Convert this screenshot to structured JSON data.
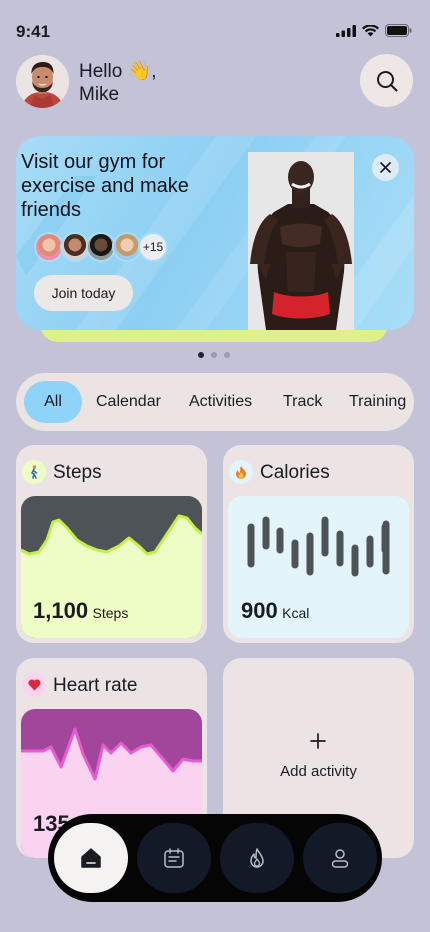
{
  "status": {
    "time": "9:41"
  },
  "header": {
    "greeting_line1": "Hello 👋,",
    "greeting_line2": "Mike"
  },
  "promo": {
    "title": "Visit our gym for exercise and make friends",
    "members_extra": "+15",
    "join_label": "Join today"
  },
  "tabs": [
    {
      "label": "All",
      "active": true
    },
    {
      "label": "Calendar"
    },
    {
      "label": "Activities"
    },
    {
      "label": "Track"
    },
    {
      "label": "Training"
    }
  ],
  "cards": {
    "steps": {
      "title": "Steps",
      "icon": "walking-person-icon",
      "value": "1,100",
      "unit": "Steps"
    },
    "calories": {
      "title": "Calories",
      "icon": "flame-icon",
      "value": "900",
      "unit": "Kcal"
    },
    "heart": {
      "title": "Heart rate",
      "icon": "heart-icon",
      "value": "135"
    },
    "add": {
      "label": "Add activity"
    }
  },
  "colors": {
    "background": "#c4c2d7",
    "accent_blue": "#8fd3f8",
    "steps_green": "#eefcc6",
    "steps_dark": "#4e5358",
    "heart_purple": "#a2469b",
    "heart_pink": "#f9d3f0",
    "calories_bg": "#e4f4fb"
  },
  "nav": [
    {
      "icon": "home-icon",
      "active": true
    },
    {
      "icon": "calendar-icon"
    },
    {
      "icon": "flame-icon"
    },
    {
      "icon": "profile-icon"
    }
  ]
}
